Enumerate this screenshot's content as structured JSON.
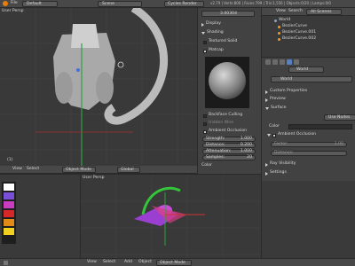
{
  "top_bar": {
    "menu_default": "Default",
    "scene": "Scene",
    "engine": "Cycles Render",
    "stats": "v2.79 | Verts:800 | Faces:799 | Tris:1,556 | Objects:0/20 | Lamps:0/0"
  },
  "viewport_top": {
    "label": "User Persp",
    "frame_label": "(1)",
    "mode": "Object Mode",
    "pivot": "Global"
  },
  "tool_panel": {
    "field_value": "3.00304",
    "display_label": "Display",
    "shading_label": "Shading",
    "textured_solid_label": "Textured Solid",
    "matcap_label": "Matcap",
    "backface_culling_label": "Backface Culling",
    "hidden_wire_label": "Hidden Wire",
    "ambient_occlusion_label": "Ambient Occlusion",
    "strength_label": "Strength:",
    "strength_value": "1.000",
    "distance_label": "Distance:",
    "distance_value": "0.200",
    "attenuation_label": "Attenuation:",
    "attenuation_value": "1.000",
    "samples_label": "Samples:",
    "samples_value": "20",
    "color_label": "Color"
  },
  "outliner": {
    "tabs": [
      "View",
      "Search",
      "All Scenes"
    ],
    "items": [
      "World",
      "BezierCurve",
      "BezierCurve.001",
      "BezierCurve.002"
    ]
  },
  "properties": {
    "world_label": "World",
    "sections": [
      "Custom Properties",
      "Preview",
      "Surface"
    ],
    "use_nodes": "Use Nodes",
    "color_label": "Color",
    "ambient_occlusion_label": "Ambient Occlusion",
    "factor_label": "Factor:",
    "factor_value": "1.00",
    "distance_label": "Distance:",
    "ray_visibility_label": "Ray Visibility",
    "settings_label": "Settings"
  },
  "bottom_bar": {
    "view": "View",
    "select": "Select",
    "add": "Add",
    "object": "Object",
    "mode": "Object Mode"
  },
  "viewport_bottom": {
    "label": "User Persp"
  },
  "palette_colors": [
    "#ffffff",
    "#7a4fd8",
    "#c93cbf",
    "#d62828",
    "#e08a18",
    "#f2d020",
    "#222222",
    "#444444"
  ],
  "colors": {
    "accent_blue": "#5680c2",
    "selection_orange": "#f29b25"
  }
}
